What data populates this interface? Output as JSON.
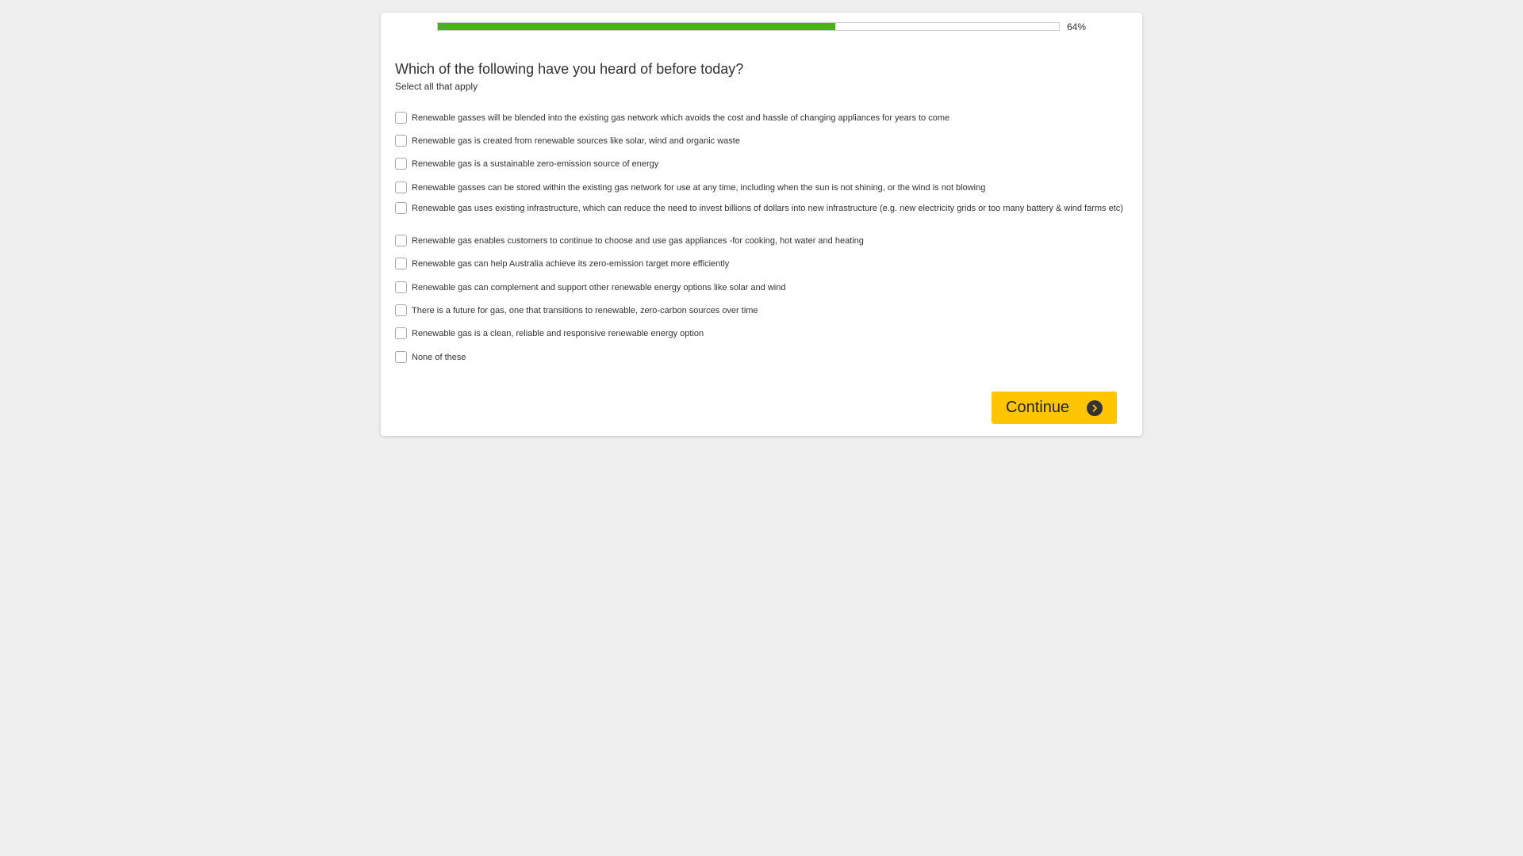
{
  "progress": {
    "percent": 64,
    "label": "64%"
  },
  "question": {
    "title": "Which of the following have you heard of before today?",
    "instruction": "Select all that apply"
  },
  "options": [
    {
      "label": "Renewable gasses will be blended into the existing gas network which avoids the cost and hassle of changing appliances for years to come",
      "checked": false
    },
    {
      "label": "Renewable gas is created from renewable sources like solar, wind and organic waste",
      "checked": false
    },
    {
      "label": "Renewable gas is a sustainable zero-emission source of energy",
      "checked": false
    },
    {
      "label": "Renewable gasses can be stored within the existing gas network for use at any time, including when the sun is not shining, or the wind is not blowing",
      "checked": false
    },
    {
      "label": "Renewable gas uses existing infrastructure, which can reduce the need to invest billions of dollars into new infrastructure (e.g. new electricity grids or too many battery & wind farms etc)",
      "checked": false
    },
    {
      "label": "Renewable gas enables customers to continue to choose and use gas appliances -for cooking, hot water and heating",
      "checked": false
    },
    {
      "label": "Renewable gas can help Australia achieve its zero-emission target more efficiently",
      "checked": false
    },
    {
      "label": "Renewable gas can complement and support other renewable energy options like solar and wind",
      "checked": false
    },
    {
      "label": "There is a future for gas, one that transitions to renewable, zero-carbon sources over time",
      "checked": false
    },
    {
      "label": "Renewable gas is a clean, reliable and responsive renewable energy option",
      "checked": false
    },
    {
      "label": "None of these",
      "checked": false
    }
  ],
  "continue_button": {
    "label": "Continue",
    "icon": "chevron-right-circle-icon"
  },
  "colors": {
    "background": "#efefef",
    "progress_fill": "#4caf1c",
    "button": "#ffc600"
  }
}
